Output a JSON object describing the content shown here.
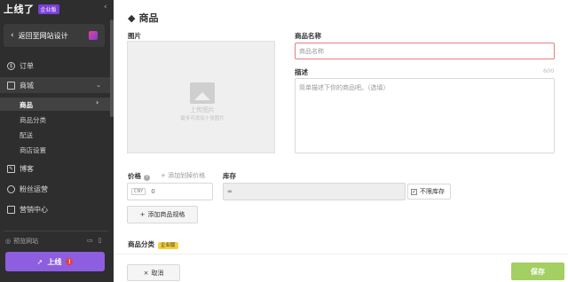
{
  "sidebar": {
    "logo": "上线了",
    "edition_badge": "企业版",
    "back_label": "返回至网站设计",
    "items": [
      {
        "label": "订单",
        "icon": "dollar-icon"
      },
      {
        "label": "商城",
        "icon": "store-icon"
      },
      {
        "label": "博客",
        "icon": "pen-icon"
      },
      {
        "label": "粉丝运营",
        "icon": "users-icon"
      },
      {
        "label": "营销中心",
        "icon": "megaphone-icon"
      }
    ],
    "sub_items": [
      {
        "label": "商品",
        "active": true
      },
      {
        "label": "商品分类"
      },
      {
        "label": "配送"
      },
      {
        "label": "商店设置"
      }
    ],
    "preview_label": "预览网站",
    "launch_label": "上线",
    "launch_alert": "!"
  },
  "main": {
    "title": "商品",
    "image": {
      "label": "图片",
      "upload_text": "上传图片",
      "upload_hint": "最多可添加十张图片"
    },
    "name": {
      "label": "商品名称",
      "placeholder": "商品名称"
    },
    "desc": {
      "label": "描述",
      "counter": "600",
      "placeholder": "简单描述下你的商品吧。（选填）"
    },
    "price": {
      "label": "价格",
      "help": "?",
      "add_original_link": "+ 添加划掉价格",
      "currency": "CNY",
      "value": "0"
    },
    "stock": {
      "label": "库存",
      "value": "∞",
      "unlimited_label": "不限库存",
      "unlimited_checked": true
    },
    "add_spec_button": "添加商品规格",
    "category": {
      "label": "商品分类",
      "badge": "企业版"
    },
    "cancel_button": "取消",
    "save_button": "保存"
  },
  "colors": {
    "sidebar_bg": "#2e2e2e",
    "accent_purple": "#8e5ee0",
    "save_green": "#a3cf63",
    "error_red": "#e87d7d",
    "badge_yellow": "#f4d03f"
  }
}
